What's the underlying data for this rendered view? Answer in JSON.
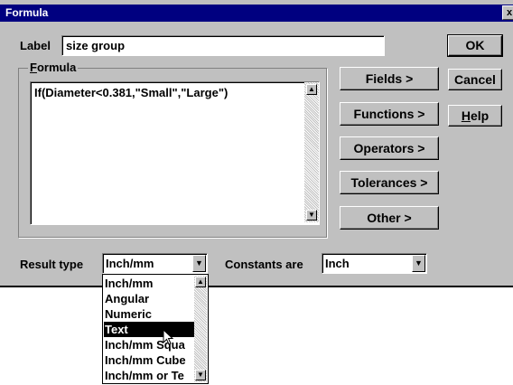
{
  "window": {
    "title": "Formula",
    "close_glyph": "x"
  },
  "label_field": {
    "caption": "Label",
    "value": "size group"
  },
  "formula": {
    "group_title": "Formula",
    "group_title_underline": "F",
    "group_title_rest": "ormula",
    "text": "If(Diameter<0.381,\"Small\",\"Large\")"
  },
  "buttons": {
    "ok": "OK",
    "cancel": "Cancel",
    "help_underline": "H",
    "help_rest": "elp",
    "fields": "Fields >",
    "functions": "Functions >",
    "operators": "Operators >",
    "tolerances": "Tolerances >",
    "other": "Other >"
  },
  "result_type": {
    "caption": "Result type",
    "value": "Inch/mm",
    "options": [
      "Inch/mm",
      "Angular",
      "Numeric",
      "Text",
      "Inch/mm Squa",
      "Inch/mm Cube",
      "Inch/mm or Te"
    ],
    "highlighted_index": 3
  },
  "constants": {
    "caption": "Constants are",
    "value": "Inch"
  },
  "icons": {
    "arrow_down": "▼",
    "arrow_up": "▲",
    "cursor": "mouse-pointer-icon"
  },
  "colors": {
    "titlebar": "#000080",
    "face": "#c0c0c0",
    "selection": "#000000"
  }
}
